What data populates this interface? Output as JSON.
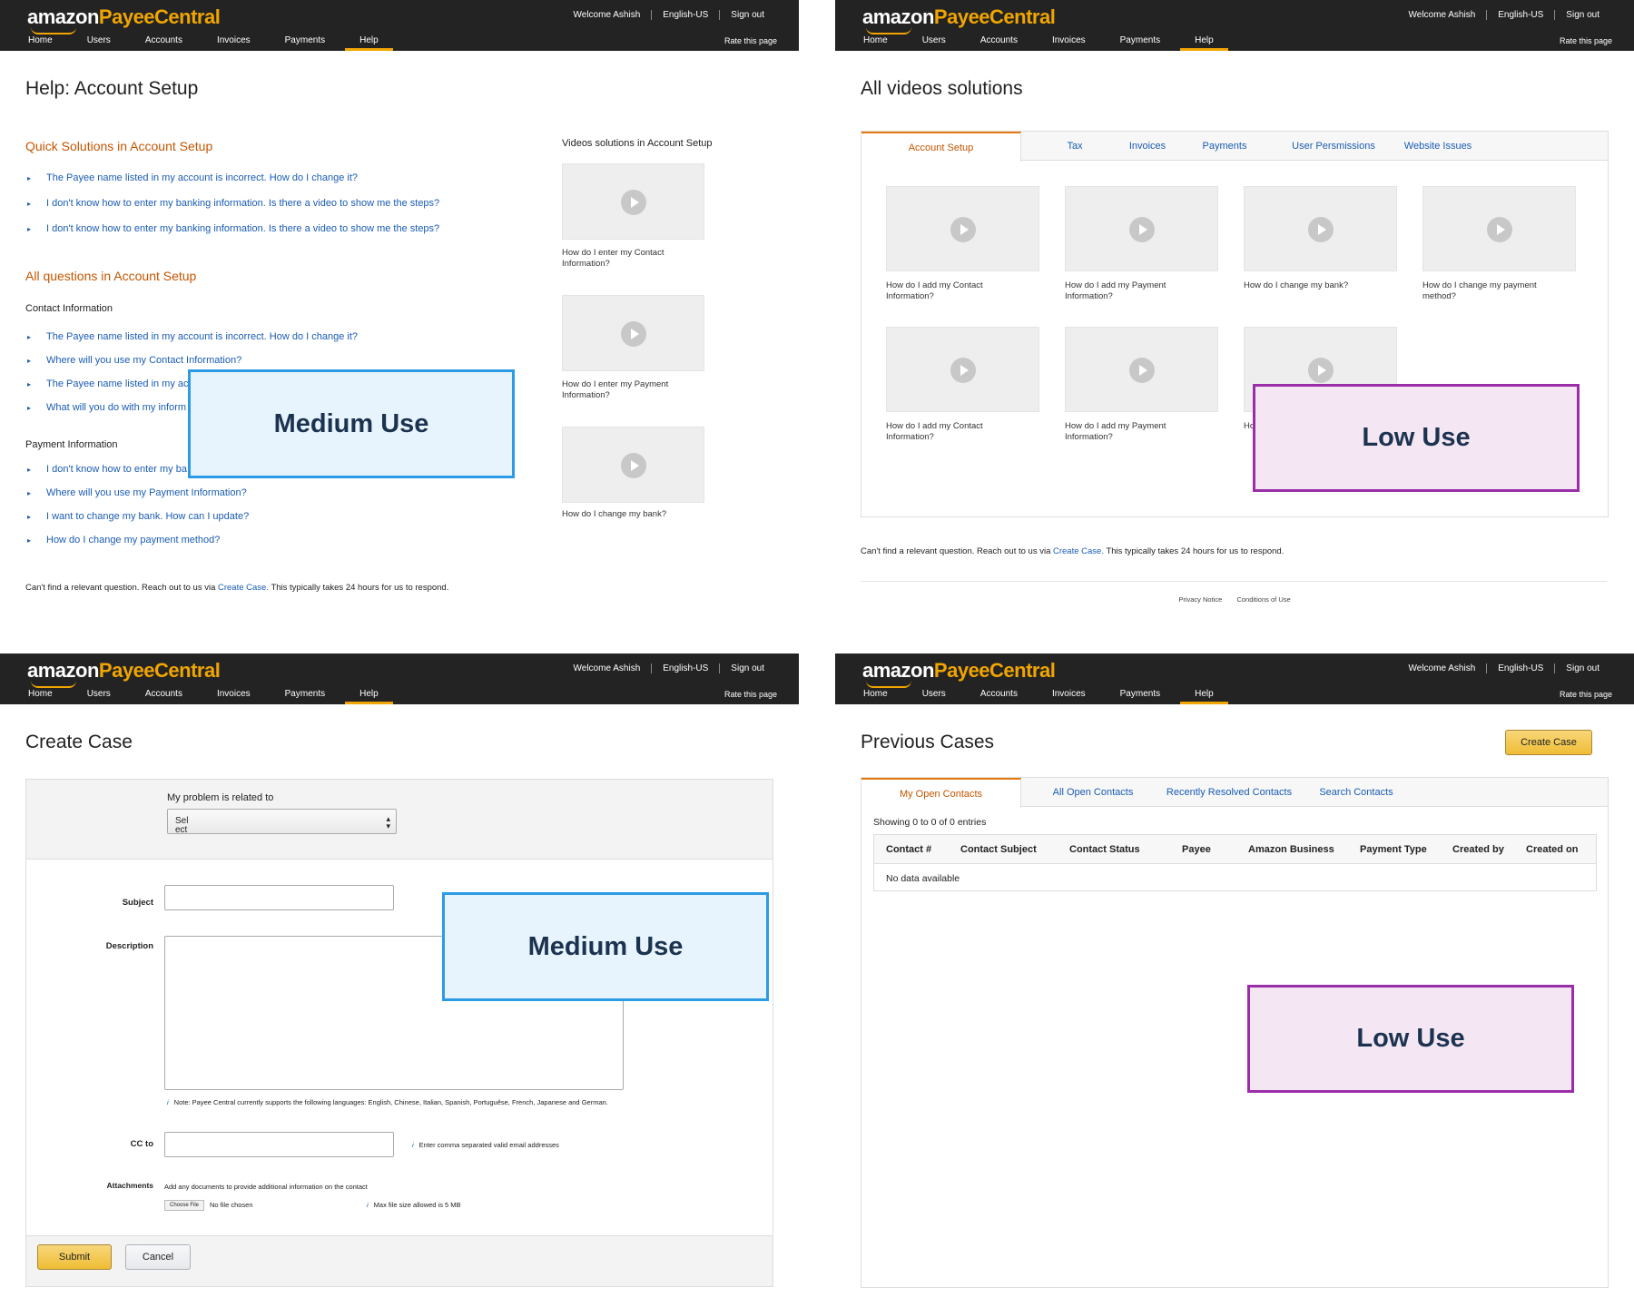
{
  "header": {
    "logo_amazon": "amazon",
    "logo_payee": "PayeeCentral",
    "welcome": "Welcome Ashish",
    "language": "English-US",
    "signout": "Sign out",
    "nav": [
      "Home",
      "Users",
      "Accounts",
      "Invoices",
      "Payments",
      "Help"
    ],
    "active_nav": "Help",
    "rate": "Rate this page",
    "brand_color": "#f0a500"
  },
  "p1": {
    "title": "Help: Account Setup",
    "quick_heading": "Quick Solutions in Account Setup",
    "quick_items": [
      "The Payee name listed in my account is incorrect. How do I change it?",
      "I don't know how to enter my banking information. Is there a video to show me the steps?",
      "I don't know how to enter my banking information. Is there a video to show me the steps?"
    ],
    "all_heading": "All questions in Account Setup",
    "contact_heading": "Contact Information",
    "contact_items": [
      "The Payee name listed in my account is incorrect. How do I change it?",
      "Where will you use my Contact Information?",
      "The Payee name listed in my acco",
      "What will you do with my inform"
    ],
    "payment_heading": "Payment Information",
    "payment_items": [
      "I don't know how to enter my ba",
      "Where will you use my Payment Information?",
      "I want to change my bank. How can I update?",
      "How do I change my payment method?"
    ],
    "videos_heading": "Videos solutions in Account Setup",
    "videos": [
      "How do I enter my Contact Information?",
      "How do I enter my Payment Information?",
      "How do I change my bank?"
    ],
    "footer_pre": "Can't find a relevant question. Reach out to us via",
    "footer_link": "Create Case.",
    "footer_post": "This typically takes 24 hours for us to respond.",
    "overlay": "Medium Use"
  },
  "p2": {
    "title": "All videos solutions",
    "tabs": [
      "Account Setup",
      "Tax",
      "Invoices",
      "Payments",
      "User Persmissions",
      "Website Issues"
    ],
    "active_tab": "Account Setup",
    "videos": [
      "How do I add my Contact Information?",
      "How do I add my Payment Information?",
      "How do I change my bank?",
      "How do I change my payment method?",
      "How do I add my Contact Information?",
      "How do I add my Payment Information?",
      "Ho"
    ],
    "footer_pre": "Can't find a relevant question. Reach out to us via",
    "footer_link": "Create Case.",
    "footer_post": "This typically takes 24 hours for us to respond.",
    "privacy": "Privacy Notice",
    "conditions": "Conditions of Use",
    "overlay": "Low Use"
  },
  "p3": {
    "title": "Create Case",
    "problem_label": "My problem is related to",
    "select_value": "Select",
    "subject_label": "Subject",
    "description_label": "Description",
    "lang_note": "Note: Payee Central currently supports the following languages: English, Chinese, Italian, Spanish, Portuguêse, French, Japanese and German.",
    "cc_label": "CC to",
    "cc_note": "Enter comma separated valid email addresses",
    "attach_label": "Attachments",
    "attach_desc": "Add any documents to provide additional information on the contact",
    "choose_file": "Choose File",
    "no_file": "No file chosen",
    "max_size": "Max file size allowed is 5 MB",
    "submit": "Submit",
    "cancel": "Cancel",
    "overlay": "Medium Use"
  },
  "p4": {
    "title": "Previous Cases",
    "create_button": "Create Case",
    "tabs": [
      "My Open Contacts",
      "All Open Contacts",
      "Recently Resolved Contacts",
      "Search Contacts"
    ],
    "active_tab": "My Open Contacts",
    "showing": "Showing 0 to 0 of 0 entries",
    "columns": [
      "Contact #",
      "Contact Subject",
      "Contact Status",
      "Payee",
      "Amazon Business",
      "Payment Type",
      "Created by",
      "Created on"
    ],
    "empty": "No data available",
    "overlay": "Low Use"
  }
}
